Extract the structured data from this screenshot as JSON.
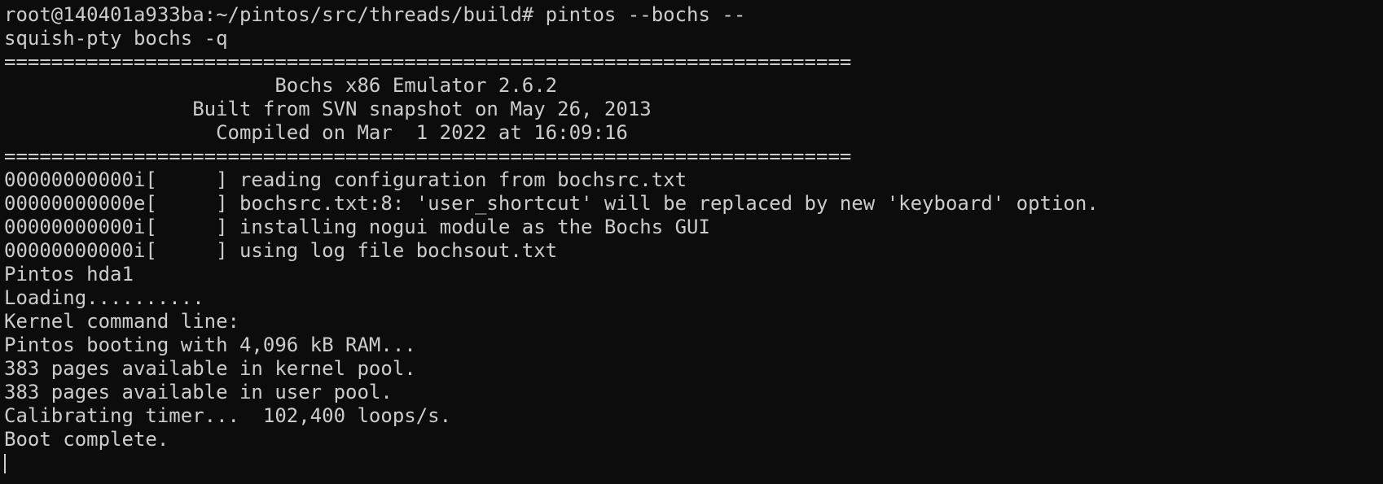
{
  "terminal": {
    "lines": [
      "root@140401a933ba:~/pintos/src/threads/build# pintos --bochs --",
      "squish-pty bochs -q",
      "========================================================================",
      "                       Bochs x86 Emulator 2.6.2",
      "                Built from SVN snapshot on May 26, 2013",
      "                  Compiled on Mar  1 2022 at 16:09:16",
      "========================================================================",
      "00000000000i[     ] reading configuration from bochsrc.txt",
      "00000000000e[     ] bochsrc.txt:8: 'user_shortcut' will be replaced by new 'keyboard' option.",
      "00000000000i[     ] installing nogui module as the Bochs GUI",
      "00000000000i[     ] using log file bochsout.txt",
      "Pintos hda1",
      "Loading..........",
      "Kernel command line:",
      "Pintos booting with 4,096 kB RAM...",
      "383 pages available in kernel pool.",
      "383 pages available in user pool.",
      "Calibrating timer...  102,400 loops/s.",
      "Boot complete."
    ],
    "colors": {
      "background": "#0c0c0c",
      "foreground": "#cccccc"
    }
  }
}
